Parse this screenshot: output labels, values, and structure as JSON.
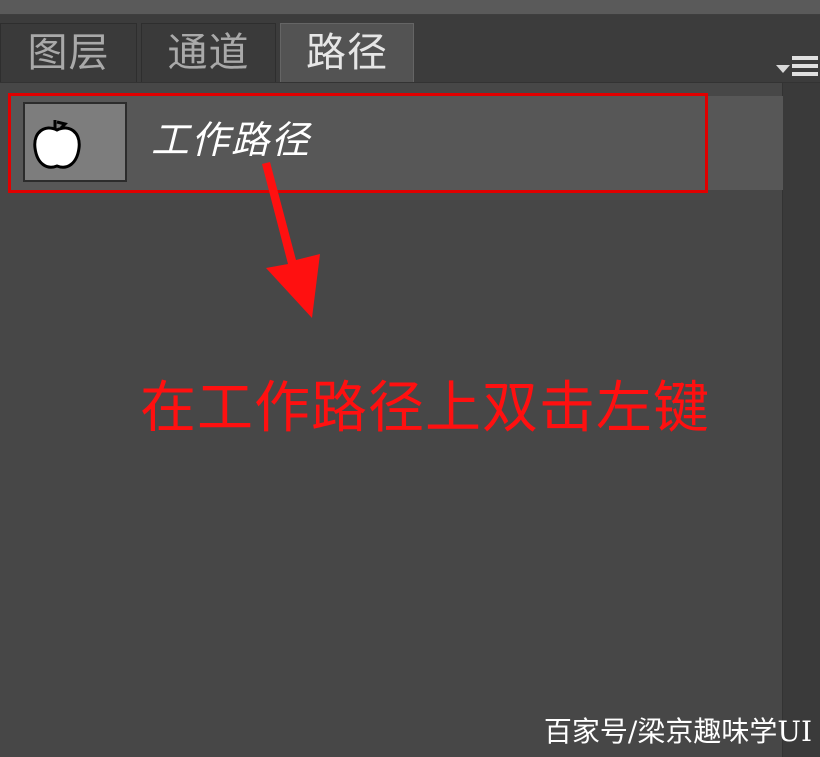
{
  "tabs": [
    {
      "label": "图层",
      "active": false
    },
    {
      "label": "通道",
      "active": false
    },
    {
      "label": "路径",
      "active": true
    }
  ],
  "panel_menu": {
    "icon": "panel-menu-icon"
  },
  "paths": [
    {
      "name": "工作路径",
      "thumbnail_icon": "apple-shape-icon",
      "highlighted": true
    }
  ],
  "annotation": {
    "text": "在工作路径上双击左键",
    "color": "#ff1010",
    "arrow_icon": "down-arrow-icon"
  },
  "watermark": "百家号/梁京趣味学UI",
  "colors": {
    "panel_bg": "#474747",
    "row_bg": "#575757",
    "highlight_border": "#e00000",
    "active_tab_bg": "#535353",
    "inactive_tab_bg": "#3a3a3a"
  }
}
